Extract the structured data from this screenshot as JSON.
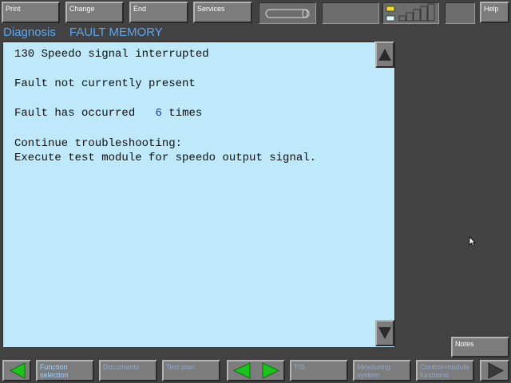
{
  "toolbar": {
    "print_label": "Print",
    "change_label": "Change",
    "end_label": "End",
    "services_label": "Services",
    "help_label": "Help"
  },
  "header": {
    "section": "Diagnosis",
    "title": "FAULT MEMORY"
  },
  "fault": {
    "code_line": "130 Speedo signal interrupted",
    "status": "Fault not currently present",
    "occurred_prefix": "Fault has occurred",
    "occurred_count": "6",
    "occurred_suffix": "times",
    "continue_label": "Continue troubleshooting:",
    "instruction": "Execute test module for speedo output signal."
  },
  "sidebar": {
    "notes_label": "Notes"
  },
  "bottom_bar": {
    "function_selection": "Function\nselection",
    "documents": "Documents",
    "test_plan": "Test plan",
    "tis": "TIS",
    "measuring_system": "Measuring\nsystem",
    "control_module_functions": "Control-module\nfunctions"
  },
  "colors": {
    "background": "#424242",
    "content_bg": "#bde9fb",
    "title_accent": "#5aa7ef",
    "button_face": "#7c7c7c",
    "arrow_green": "#19c519"
  },
  "icons": [
    "battery-icon",
    "connection-status-icon",
    "signal-strength-icon",
    "scroll-up-icon",
    "scroll-down-icon",
    "arrow-left-icon",
    "arrow-right-icon",
    "mouse-cursor-icon"
  ]
}
